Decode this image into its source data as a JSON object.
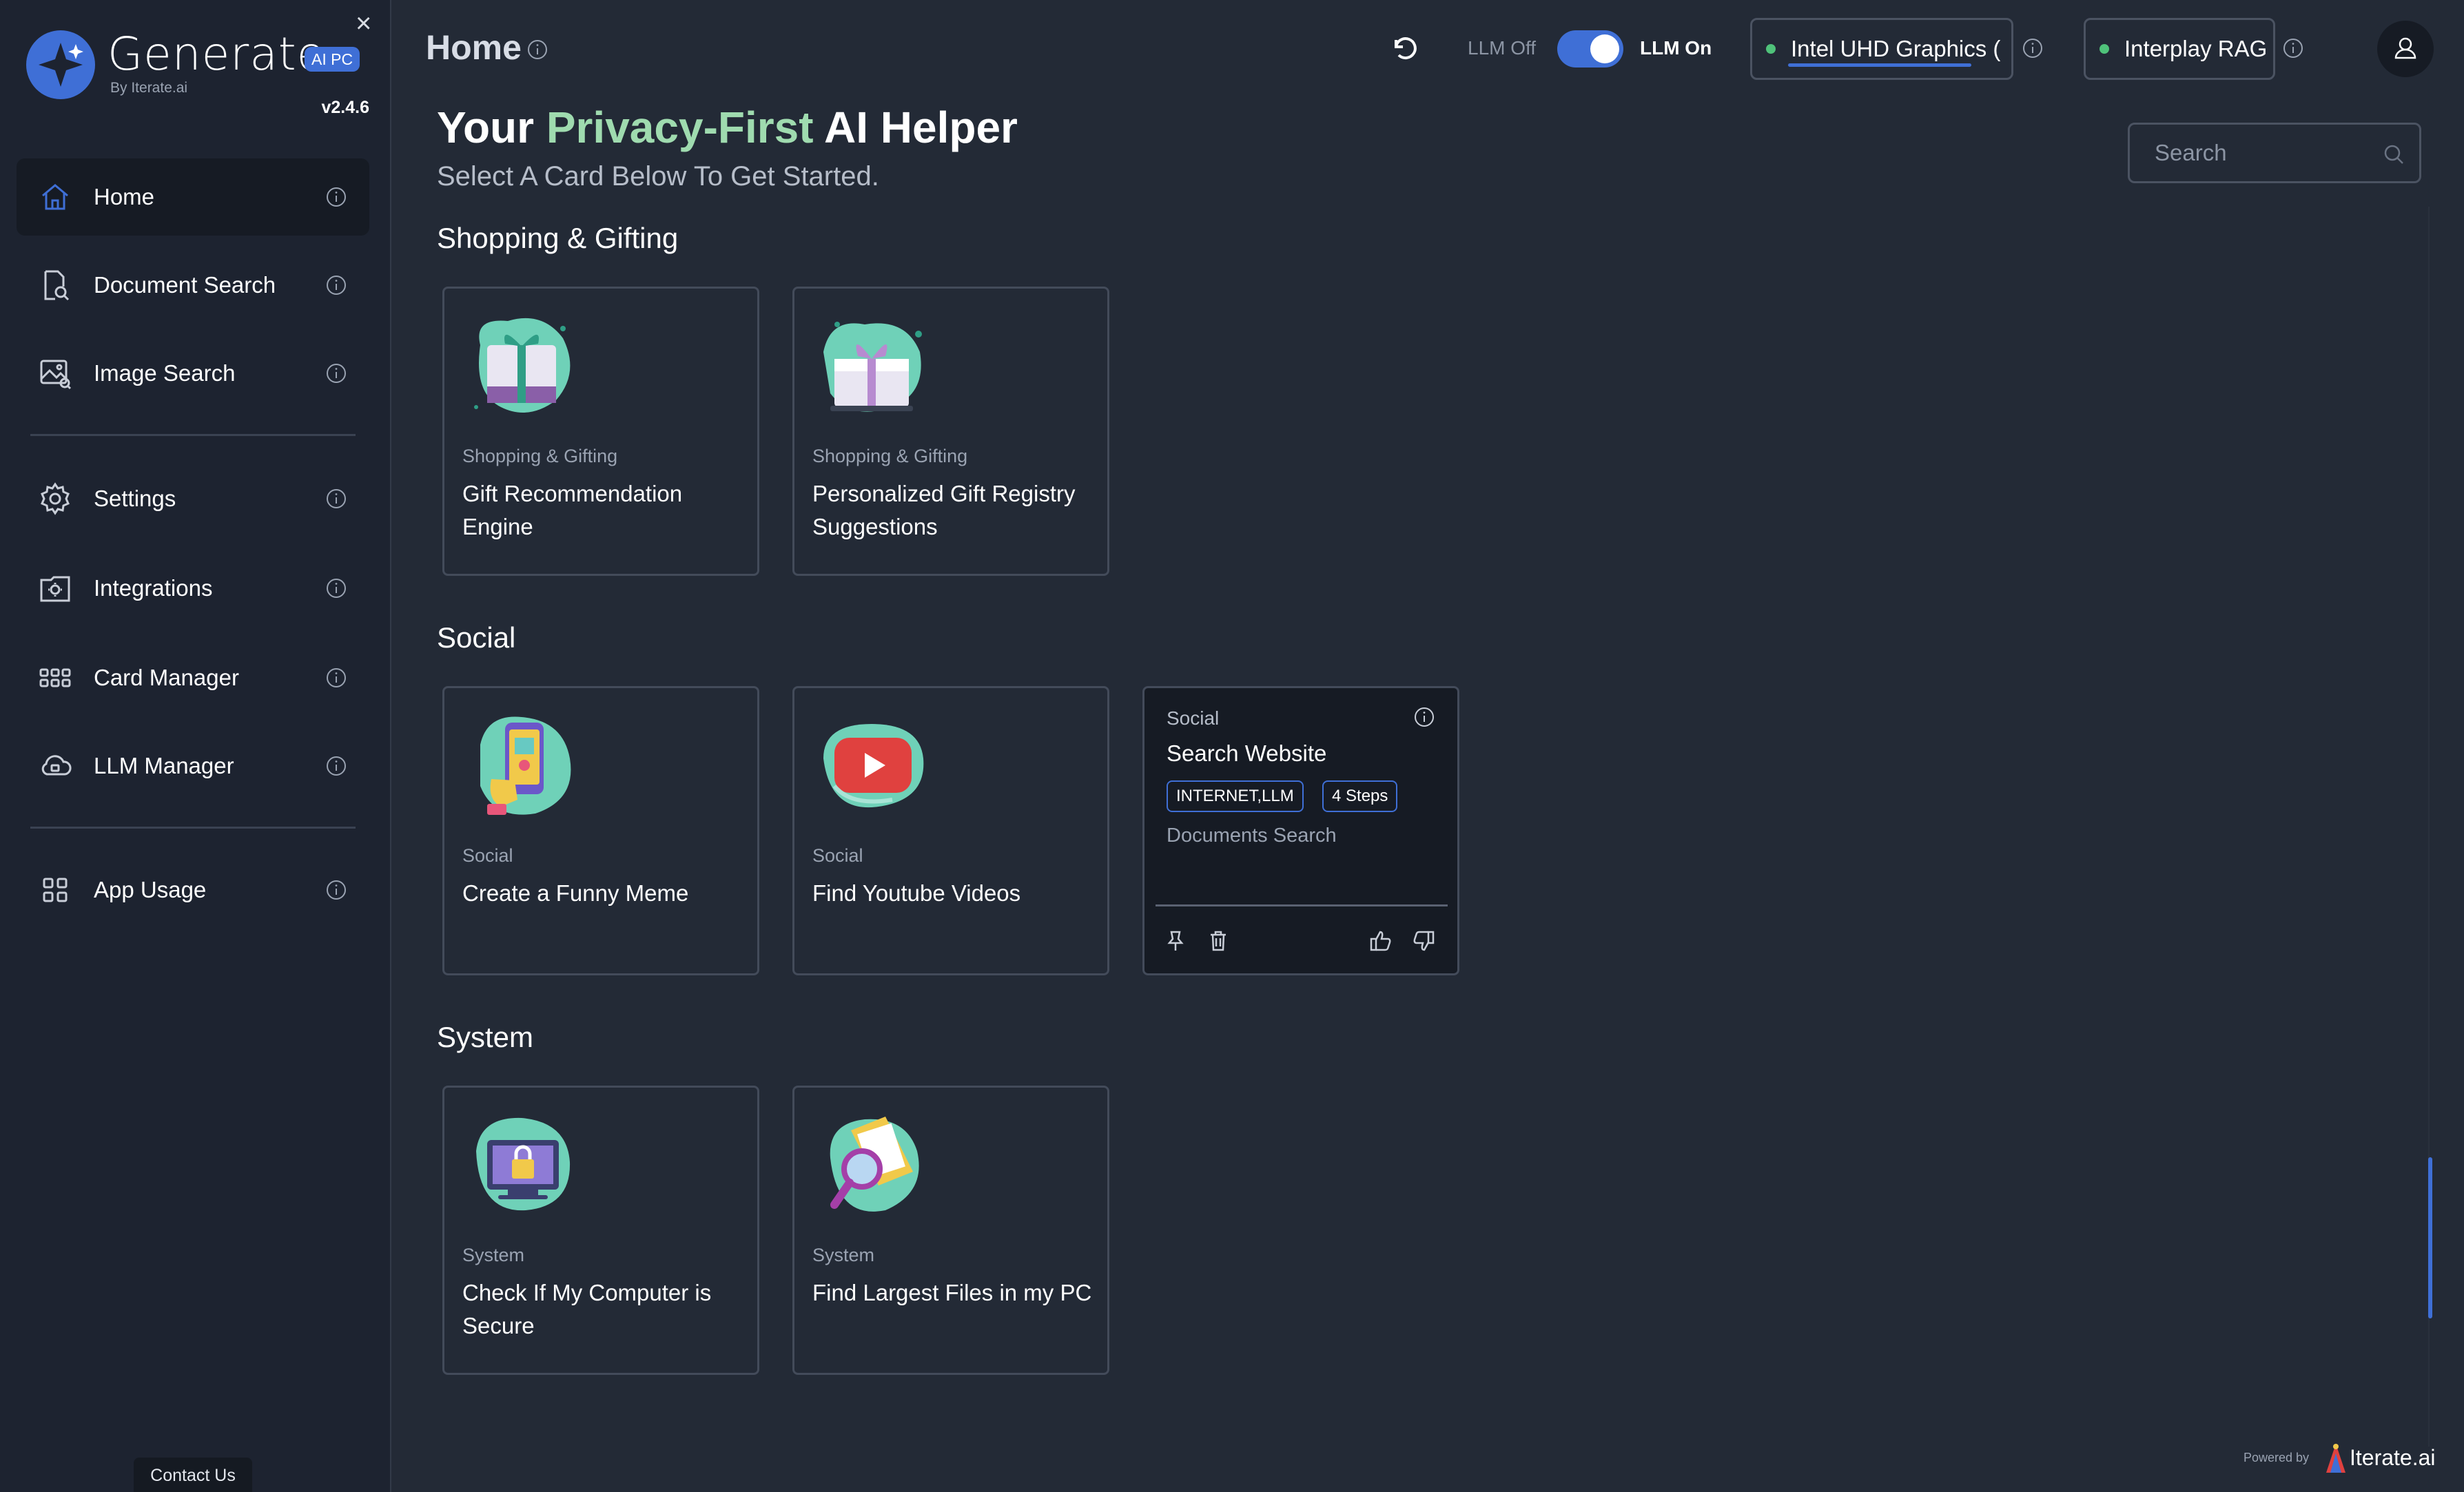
{
  "sidebar": {
    "brand": "Generate",
    "badge": "AI PC",
    "byline": "By Iterate.ai",
    "version": "v2.4.6",
    "close": "×",
    "items": [
      {
        "label": "Home",
        "icon": "home-icon"
      },
      {
        "label": "Document Search",
        "icon": "document-search-icon"
      },
      {
        "label": "Image Search",
        "icon": "image-search-icon"
      },
      {
        "label": "Settings",
        "icon": "gear-icon"
      },
      {
        "label": "Integrations",
        "icon": "integrations-icon"
      },
      {
        "label": "Card Manager",
        "icon": "grid-icon"
      },
      {
        "label": "LLM Manager",
        "icon": "cloud-chip-icon"
      },
      {
        "label": "App Usage",
        "icon": "apps-icon"
      }
    ],
    "contact": "Contact Us"
  },
  "header": {
    "title": "Home",
    "llm_off": "LLM Off",
    "llm_on": "LLM On",
    "gpu": "Intel UHD Graphics (",
    "rag": "Interplay RAG"
  },
  "hero": {
    "pre": "Your",
    "accent": "Privacy-First",
    "post": "AI Helper",
    "subtitle": "Select A Card Below To Get Started.",
    "search_placeholder": "Search"
  },
  "sections": {
    "shopping": "Shopping & Gifting",
    "social": "Social",
    "system": "System"
  },
  "cards": [
    {
      "category": "Shopping & Gifting",
      "title": "Gift Recommendation Engine",
      "icon": "gift-illustration-icon"
    },
    {
      "category": "Shopping & Gifting",
      "title": "Personalized Gift Registry Suggestions",
      "icon": "gift-box-illustration-icon"
    },
    {
      "category": "Social",
      "title": "Create a Funny Meme",
      "icon": "phone-meme-illustration-icon"
    },
    {
      "category": "Social",
      "title": "Find Youtube Videos",
      "icon": "youtube-play-illustration-icon"
    },
    {
      "category": "System",
      "title": "Check If My Computer is Secure",
      "icon": "computer-lock-illustration-icon"
    },
    {
      "category": "System",
      "title": "Find Largest Files in my PC",
      "icon": "file-magnifier-illustration-icon"
    }
  ],
  "detail_card": {
    "category": "Social",
    "title": "Search Website",
    "tag1": "INTERNET,LLM",
    "tag2": "4 Steps",
    "subtitle": "Documents Search"
  },
  "footer": {
    "powered": "Powered by",
    "brand": "Iterate.ai"
  },
  "colors": {
    "accent": "#3f6fd6",
    "highlight": "#9fdbaf",
    "status_ok": "#4fc27a"
  }
}
